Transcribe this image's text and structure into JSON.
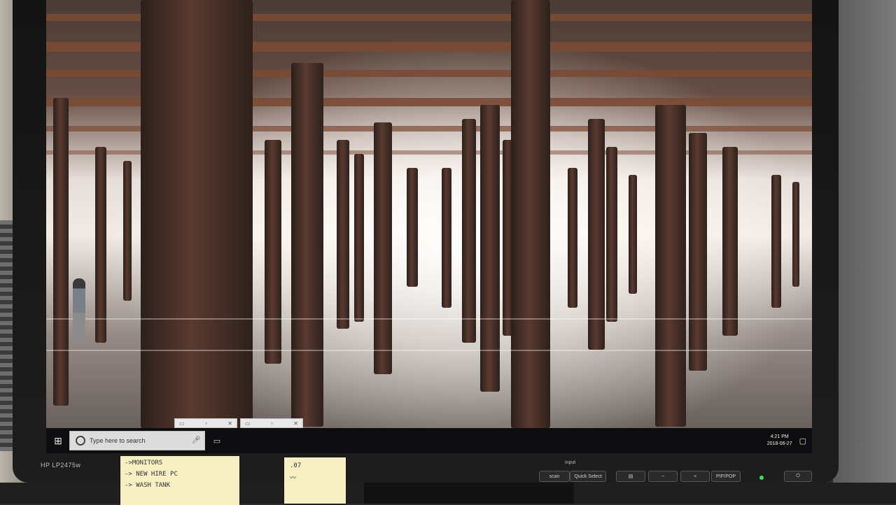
{
  "taskbar": {
    "search_placeholder": "Type here to search",
    "clock_time": "4:21 PM",
    "clock_date": "2018-06-27"
  },
  "monitor": {
    "brand": "HP LP2475w",
    "input_label": "input",
    "buttons": {
      "scan": "scan",
      "quick_select": "Quick Select",
      "pip_pop": "PIP/POP",
      "minus": "−",
      "plus": "+"
    }
  },
  "sticky_notes": {
    "left": [
      "->MONITORS",
      "-> NEW HIRE PC",
      "-> WASH TANK"
    ],
    "right": [
      ".07"
    ]
  },
  "icons": {
    "start": "start-icon",
    "search": "cortana-icon",
    "mic": "microphone-icon",
    "task_view": "task-view-icon",
    "notifications": "action-center-icon",
    "power": "power-icon"
  }
}
